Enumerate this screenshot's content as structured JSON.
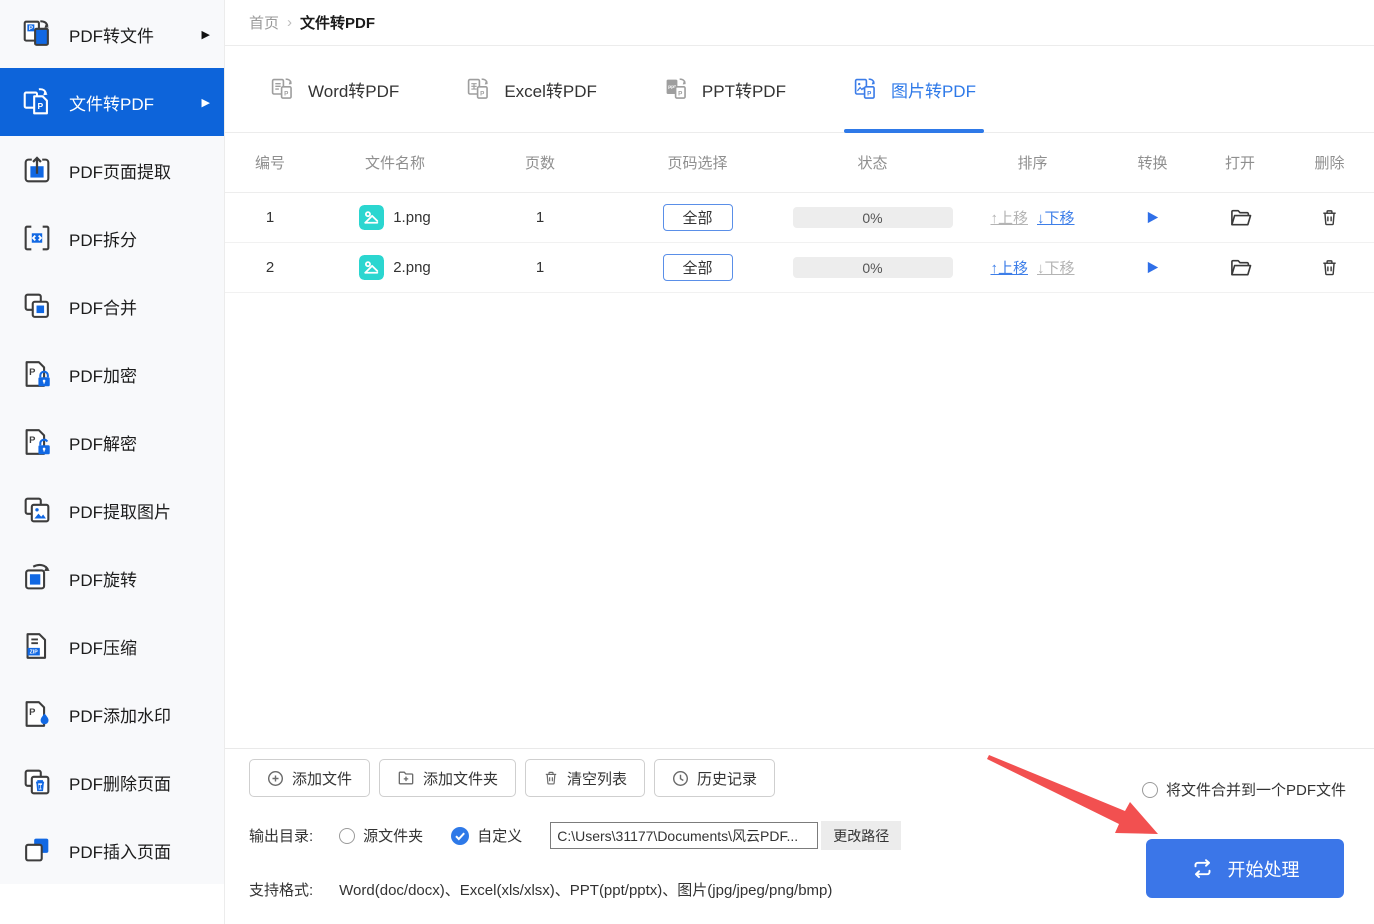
{
  "colors": {
    "sidebar_active_blue": "#0d64da",
    "tab_active_blue": "#2e79e8",
    "link_blue": "#3d7ee8",
    "start_button_blue": "#3b76e8",
    "file_icon_teal": "#2bd6d0",
    "annotation_arrow_red": "#f25050"
  },
  "sidebar": {
    "items": [
      {
        "label": "PDF转文件",
        "arrow": "▶"
      },
      {
        "label": "文件转PDF",
        "arrow": "▶"
      },
      {
        "label": "PDF页面提取"
      },
      {
        "label": "PDF拆分"
      },
      {
        "label": "PDF合并"
      },
      {
        "label": "PDF加密"
      },
      {
        "label": "PDF解密"
      },
      {
        "label": "PDF提取图片"
      },
      {
        "label": "PDF旋转"
      },
      {
        "label": "PDF压缩"
      },
      {
        "label": "PDF添加水印"
      },
      {
        "label": "PDF删除页面"
      },
      {
        "label": "PDF插入页面"
      }
    ]
  },
  "breadcrumb": {
    "home": "首页",
    "separator": "›",
    "current": "文件转PDF"
  },
  "tabs": [
    {
      "label": "Word转PDF"
    },
    {
      "label": "Excel转PDF"
    },
    {
      "label": "PPT转PDF"
    },
    {
      "label": "图片转PDF",
      "active": true
    }
  ],
  "table": {
    "headers": [
      "编号",
      "文件名称",
      "页数",
      "页码选择",
      "状态",
      "排序",
      "转换",
      "打开",
      "删除"
    ],
    "sort": {
      "up_label": "↑上移",
      "down_label": "↓下移"
    },
    "rows": [
      {
        "index": "1",
        "filename": "1.png",
        "pages": "1",
        "page_select": "全部",
        "progress": "0%"
      },
      {
        "index": "2",
        "filename": "2.png",
        "pages": "1",
        "page_select": "全部",
        "progress": "0%"
      }
    ]
  },
  "actions": {
    "add_file": "添加文件",
    "add_folder": "添加文件夹",
    "clear_list": "清空列表",
    "history": "历史记录"
  },
  "output": {
    "label": "输出目录:",
    "source_folder": "源文件夹",
    "custom": "自定义",
    "path": "C:\\Users\\31177\\Documents\\风云PDF...",
    "change_path": "更改路径"
  },
  "formats": {
    "label": "支持格式:",
    "value": "Word(doc/docx)、Excel(xls/xlsx)、PPT(ppt/pptx)、图片(jpg/jpeg/png/bmp)"
  },
  "merge": {
    "label": "将文件合并到一个PDF文件"
  },
  "start": {
    "label": "开始处理"
  }
}
